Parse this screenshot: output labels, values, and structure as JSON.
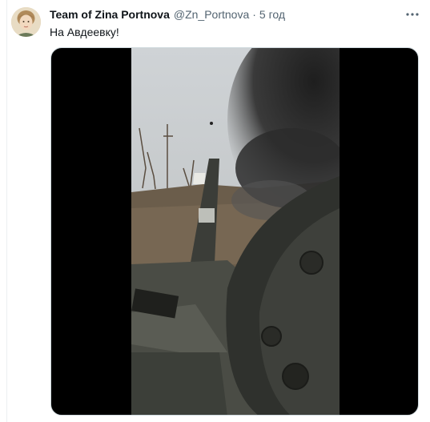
{
  "tweet": {
    "author_name": "Team of Zina Portnova",
    "handle": "@Zn_Portnova",
    "separator": "·",
    "time": "5 год",
    "text": "На Авдеевку!",
    "more_icon": "more-horizontal-icon"
  },
  "media": {
    "type": "video",
    "icon": "video-frame"
  },
  "colors": {
    "name": "#0f1419",
    "secondary": "#536471",
    "media_bg": "#000000"
  }
}
